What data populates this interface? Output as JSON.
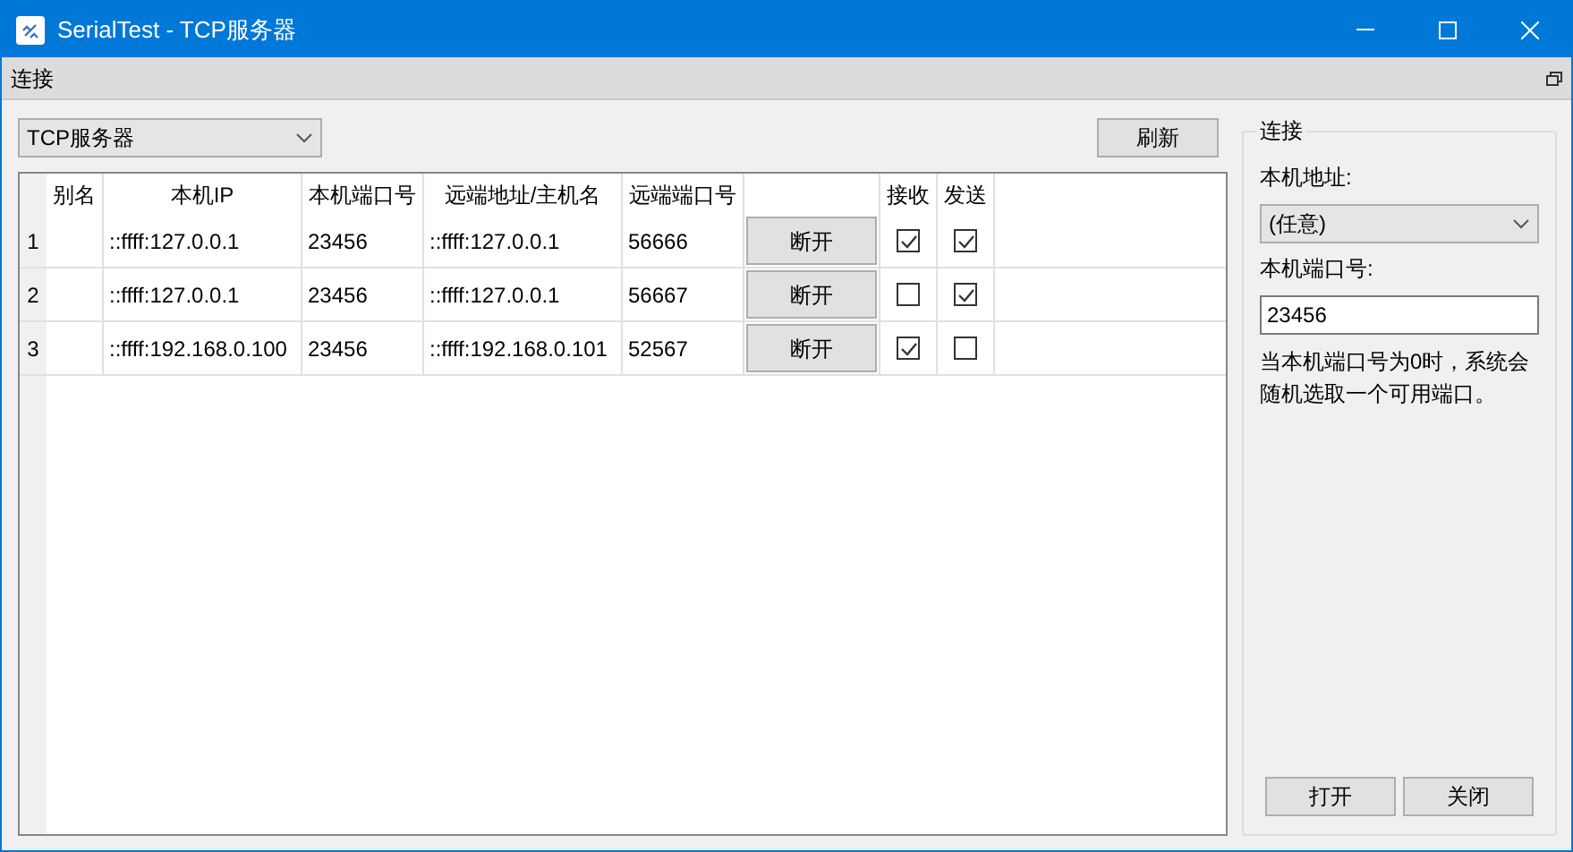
{
  "window": {
    "title": "SerialTest - TCP服务器"
  },
  "dock": {
    "title": "连接"
  },
  "mode_select": {
    "value": "TCP服务器"
  },
  "refresh_button": "刷新",
  "table": {
    "columns": [
      "别名",
      "本机IP",
      "本机端口号",
      "远端地址/主机名",
      "远端端口号",
      "",
      "接收",
      "发送"
    ],
    "rows": [
      {
        "index": "1",
        "alias": "",
        "local_ip": "::ffff:127.0.0.1",
        "local_port": "23456",
        "remote": "::ffff:127.0.0.1",
        "remote_port": "56666",
        "action": "断开",
        "receive": true,
        "send": true
      },
      {
        "index": "2",
        "alias": "",
        "local_ip": "::ffff:127.0.0.1",
        "local_port": "23456",
        "remote": "::ffff:127.0.0.1",
        "remote_port": "56667",
        "action": "断开",
        "receive": false,
        "send": true
      },
      {
        "index": "3",
        "alias": "",
        "local_ip": "::ffff:192.168.0.100",
        "local_port": "23456",
        "remote": "::ffff:192.168.0.101",
        "remote_port": "52567",
        "action": "断开",
        "receive": true,
        "send": false
      }
    ]
  },
  "connection": {
    "title": "连接",
    "address_label": "本机地址:",
    "address_value": "(任意)",
    "port_label": "本机端口号:",
    "port_value": "23456",
    "hint": "当本机端口号为0时，系统会随机选取一个可用端口。",
    "buttons": [
      "打开",
      "关闭"
    ]
  }
}
